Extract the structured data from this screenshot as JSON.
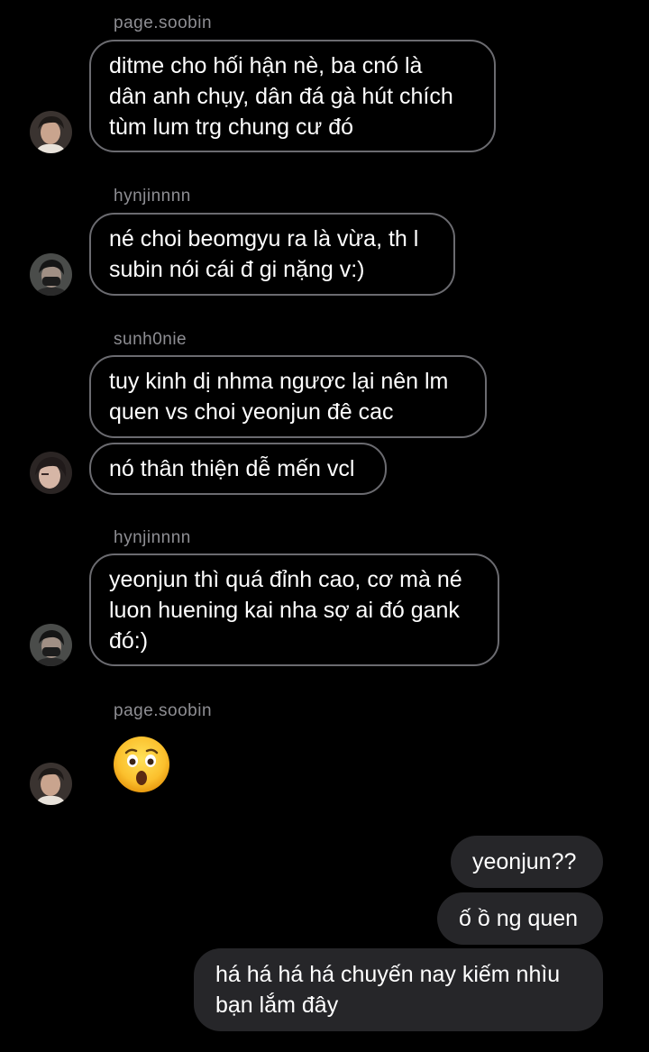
{
  "messages": [
    {
      "sender": "page.soobin",
      "bubbles": [
        [
          "ditme cho hối hận nè, ba cnó là",
          "dân anh chụy, dân đá gà hút chích",
          "tùm lum trg chung cư đó"
        ]
      ]
    },
    {
      "sender": "hynjinnnn",
      "bubbles": [
        [
          "né choi beomgyu ra là vừa, th l",
          "subin nói cái đ gi nặng v:)"
        ]
      ]
    },
    {
      "sender": "sunh0nie",
      "bubbles": [
        [
          "tuy kinh dị nhma ngược lại nên lm",
          "quen vs choi yeonjun đê cac"
        ],
        [
          "nó thân thiện dễ mến vcl"
        ]
      ]
    },
    {
      "sender": "hynjinnnn",
      "bubbles": [
        [
          "yeonjun thì quá đỉnh cao, cơ mà  né",
          "luon huening kai nha sợ ai đó gank",
          "đó:)"
        ]
      ]
    },
    {
      "sender": "page.soobin",
      "emoji": "astonished-face"
    }
  ],
  "outgoing": [
    [
      "yeonjun??"
    ],
    [
      "ố ồ ng quen"
    ],
    [
      "há há há há chuyến nay  kiếm nhìu",
      "bạn lắm đây"
    ]
  ],
  "colors": {
    "background": "#000000",
    "incoming_border": "#6b6b70",
    "outgoing_bg": "#262629",
    "sender_name": "#8e8e93",
    "text": "#ffffff"
  }
}
